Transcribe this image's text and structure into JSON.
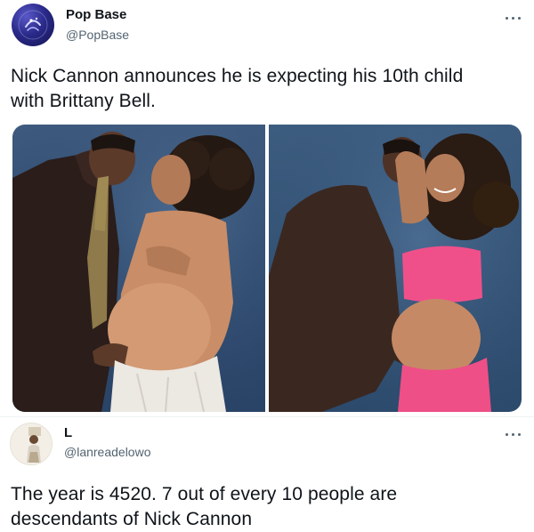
{
  "tweet": {
    "author": {
      "display_name": "Pop Base",
      "handle": "@PopBase",
      "avatar_icon": "pop-base-logo"
    },
    "text_line1": "Nick Cannon announces he is expecting his 10th child",
    "text_line2": "with Brittany Bell.",
    "media": [
      {
        "description_icon": "photo-left"
      },
      {
        "description_icon": "photo-right"
      }
    ]
  },
  "reply": {
    "author": {
      "display_name": "L",
      "handle": "@lanreadelowo",
      "avatar_icon": "user-avatar"
    },
    "text_line1": "The year is 4520. 7 out of every 10 people are",
    "text_line2": "descendants of Nick Cannon"
  },
  "colors": {
    "text_primary": "#0f1419",
    "text_secondary": "#536471",
    "photo_backdrop": "#2f4b70",
    "pink_top": "#f0508a"
  }
}
